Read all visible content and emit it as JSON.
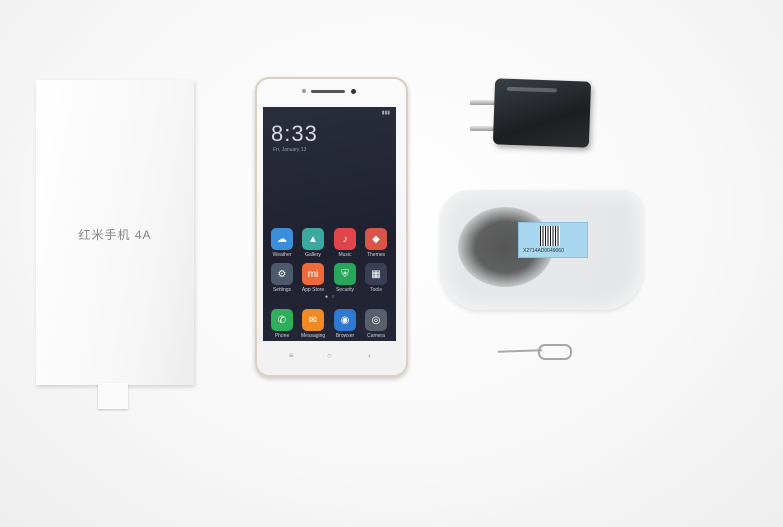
{
  "manual": {
    "title": "红米手机 4A"
  },
  "phone": {
    "time": "8:33",
    "date": "Fri, January 13",
    "apps": [
      {
        "label": "Weather",
        "color": "#3b8ed8",
        "glyph": "☁"
      },
      {
        "label": "Gallery",
        "color": "#3ba99f",
        "glyph": "▲"
      },
      {
        "label": "Music",
        "color": "#e2444b",
        "glyph": "♪"
      },
      {
        "label": "Themes",
        "color": "#d9554a",
        "glyph": "◆"
      },
      {
        "label": "Settings",
        "color": "#4d5a6e",
        "glyph": "⚙"
      },
      {
        "label": "App Store",
        "color": "#ef6a3a",
        "glyph": "mi"
      },
      {
        "label": "Security",
        "color": "#27a65c",
        "glyph": "⛨"
      },
      {
        "label": "Tools",
        "color": "#3a3f55",
        "glyph": "▦"
      },
      {
        "label": "Phone",
        "color": "#2fae5e",
        "glyph": "✆"
      },
      {
        "label": "Messaging",
        "color": "#f08a24",
        "glyph": "✉"
      },
      {
        "label": "Browser",
        "color": "#2f79d1",
        "glyph": "◉"
      },
      {
        "label": "Camera",
        "color": "#5b5f6b",
        "glyph": "◎"
      }
    ],
    "nav": [
      "≡",
      "○",
      "‹"
    ]
  },
  "earphones_label": {
    "code": "X2714AD0049060"
  }
}
